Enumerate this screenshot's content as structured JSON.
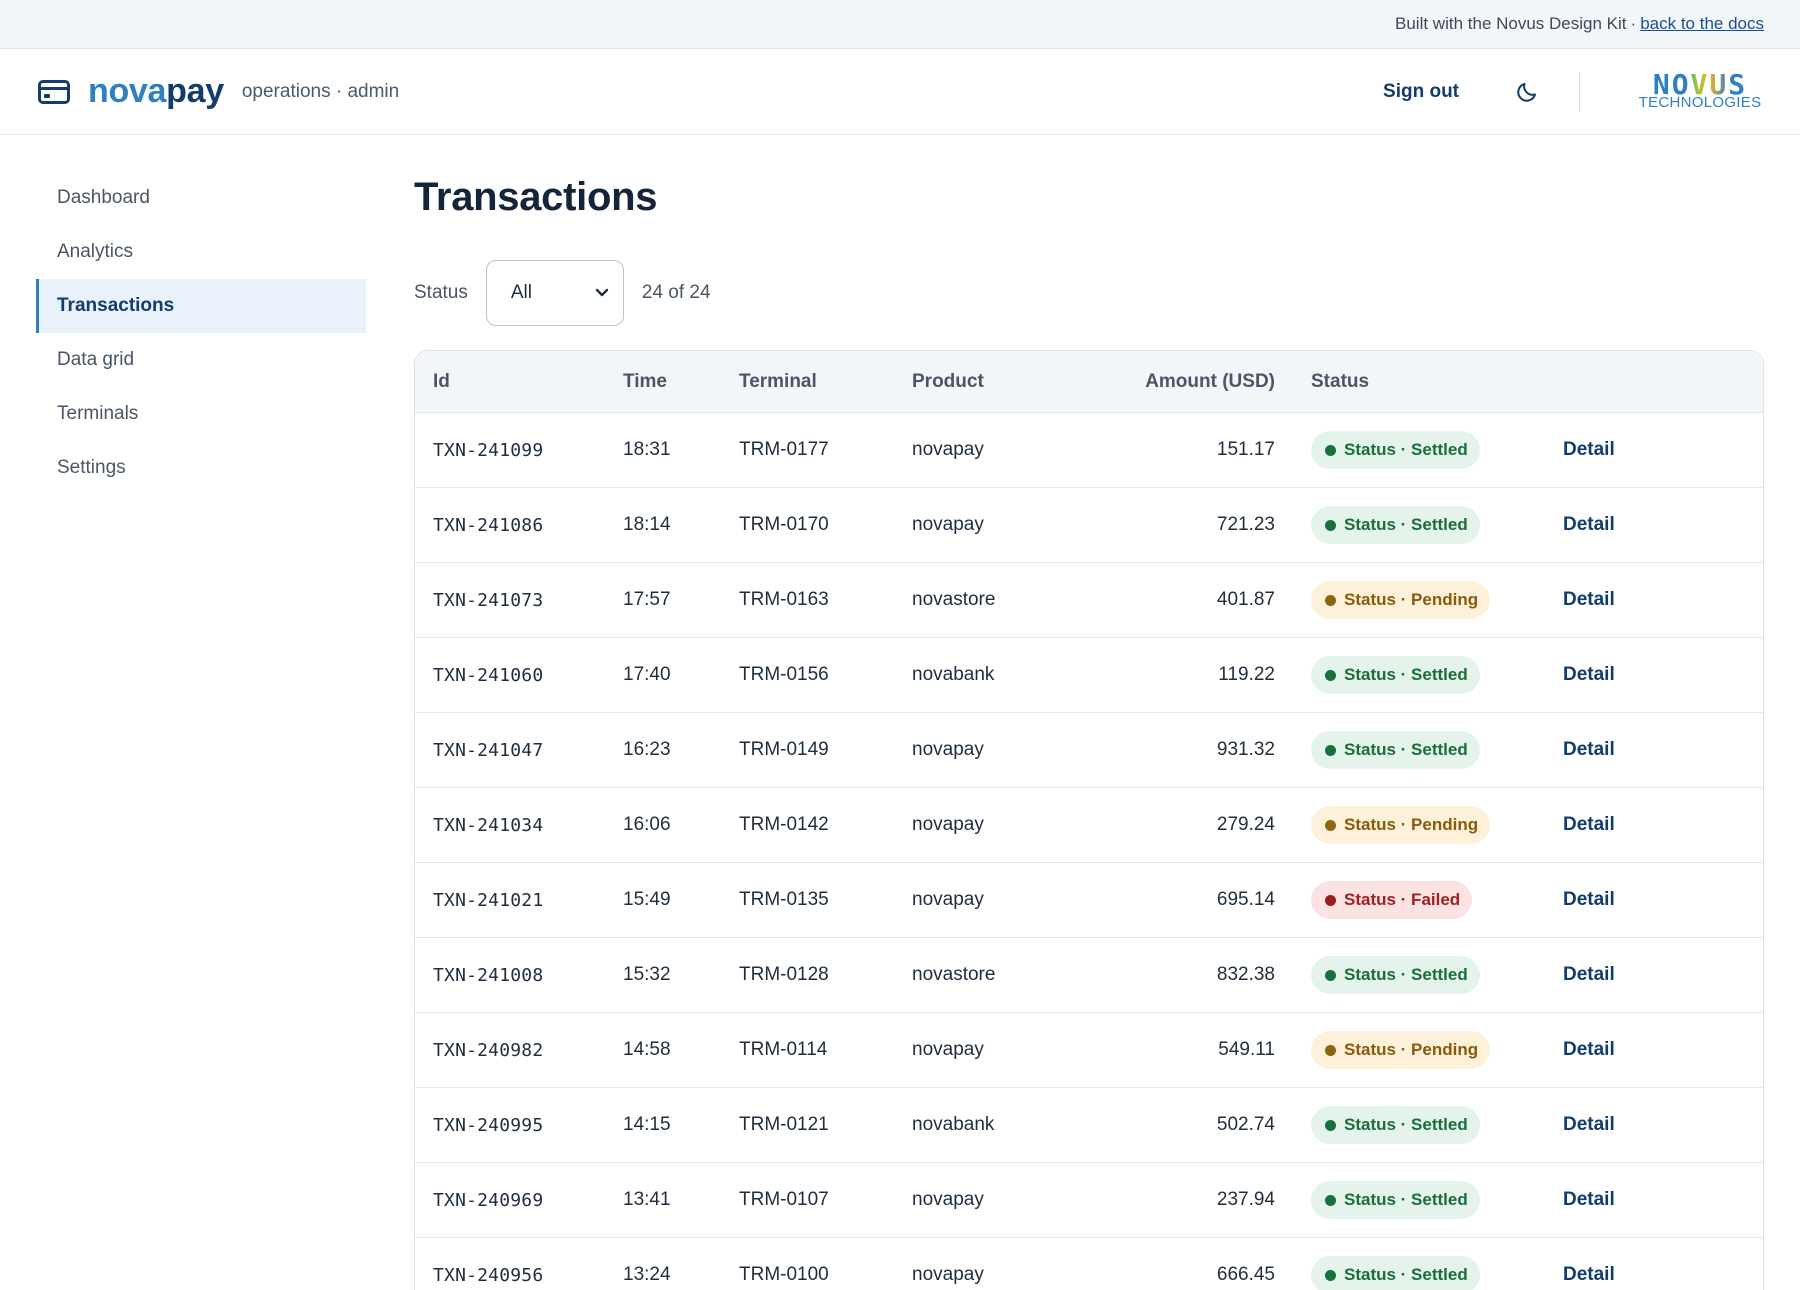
{
  "notice": {
    "text": "Built with the Novus Design Kit",
    "separator": "·",
    "link": "back to the docs"
  },
  "header": {
    "brand_icon": "card-icon",
    "brand_part1": "nova",
    "brand_part2": "pay",
    "subtitle": "operations · admin",
    "signout_label": "Sign out",
    "theme_icon": "moon-icon",
    "corp_logo_text": "NOVUS",
    "corp_logo_sub": "TECHNOLOGIES"
  },
  "sidebar": {
    "items": [
      {
        "label": "Dashboard",
        "active": false
      },
      {
        "label": "Analytics",
        "active": false
      },
      {
        "label": "Transactions",
        "active": true
      },
      {
        "label": "Data grid",
        "active": false
      },
      {
        "label": "Terminals",
        "active": false
      },
      {
        "label": "Settings",
        "active": false
      }
    ]
  },
  "main": {
    "title": "Transactions",
    "filter": {
      "label": "Status",
      "selected": "All",
      "count": "24 of 24"
    },
    "table": {
      "columns": [
        "Id",
        "Time",
        "Terminal",
        "Product",
        "Amount (USD)",
        "Status",
        ""
      ],
      "action_label": "Detail",
      "rows": [
        {
          "id": "TXN-241099",
          "time": "18:31",
          "terminal": "TRM-0177",
          "product": "novapay",
          "amount": "151.17",
          "status": "Status · Settled",
          "kind": "settled"
        },
        {
          "id": "TXN-241086",
          "time": "18:14",
          "terminal": "TRM-0170",
          "product": "novapay",
          "amount": "721.23",
          "status": "Status · Settled",
          "kind": "settled"
        },
        {
          "id": "TXN-241073",
          "time": "17:57",
          "terminal": "TRM-0163",
          "product": "novastore",
          "amount": "401.87",
          "status": "Status · Pending",
          "kind": "pending"
        },
        {
          "id": "TXN-241060",
          "time": "17:40",
          "terminal": "TRM-0156",
          "product": "novabank",
          "amount": "119.22",
          "status": "Status · Settled",
          "kind": "settled"
        },
        {
          "id": "TXN-241047",
          "time": "16:23",
          "terminal": "TRM-0149",
          "product": "novapay",
          "amount": "931.32",
          "status": "Status · Settled",
          "kind": "settled"
        },
        {
          "id": "TXN-241034",
          "time": "16:06",
          "terminal": "TRM-0142",
          "product": "novapay",
          "amount": "279.24",
          "status": "Status · Pending",
          "kind": "pending"
        },
        {
          "id": "TXN-241021",
          "time": "15:49",
          "terminal": "TRM-0135",
          "product": "novapay",
          "amount": "695.14",
          "status": "Status · Failed",
          "kind": "failed"
        },
        {
          "id": "TXN-241008",
          "time": "15:32",
          "terminal": "TRM-0128",
          "product": "novastore",
          "amount": "832.38",
          "status": "Status · Settled",
          "kind": "settled"
        },
        {
          "id": "TXN-240982",
          "time": "14:58",
          "terminal": "TRM-0114",
          "product": "novapay",
          "amount": "549.11",
          "status": "Status · Pending",
          "kind": "pending"
        },
        {
          "id": "TXN-240995",
          "time": "14:15",
          "terminal": "TRM-0121",
          "product": "novabank",
          "amount": "502.74",
          "status": "Status · Settled",
          "kind": "settled"
        },
        {
          "id": "TXN-240969",
          "time": "13:41",
          "terminal": "TRM-0107",
          "product": "novapay",
          "amount": "237.94",
          "status": "Status · Settled",
          "kind": "settled"
        },
        {
          "id": "TXN-240956",
          "time": "13:24",
          "terminal": "TRM-0100",
          "product": "novapay",
          "amount": "666.45",
          "status": "Status · Settled",
          "kind": "settled"
        }
      ]
    }
  },
  "colors": {
    "brand_light": "#2f7fc1",
    "brand_dark": "#123c6b",
    "settled": "#17703d",
    "pending": "#8d6414",
    "failed": "#9b1c1c"
  }
}
